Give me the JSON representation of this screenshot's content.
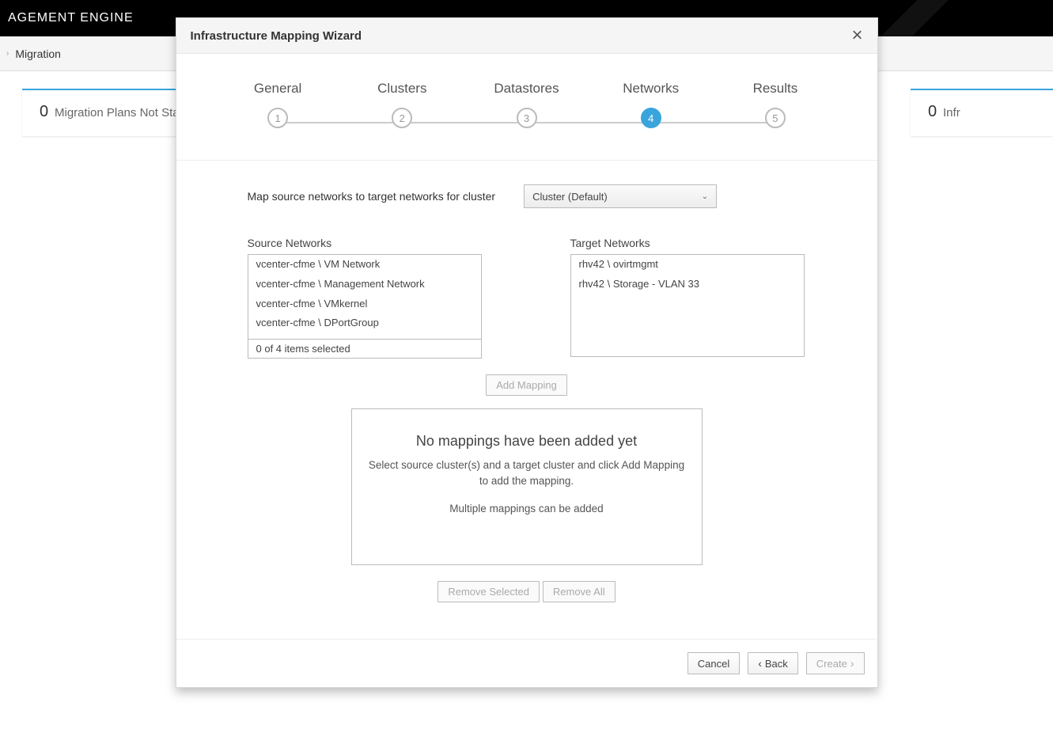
{
  "topbar": {
    "brand_left": "AGEMENT ENGINE"
  },
  "breadcrumb": {
    "item": "Migration"
  },
  "cards": {
    "left_num": "0",
    "left_text": "Migration Plans Not Sta",
    "right_num": "0",
    "right_text": "Infr"
  },
  "modal": {
    "title": "Infrastructure Mapping Wizard",
    "steps": [
      "General",
      "Clusters",
      "Datastores",
      "Networks",
      "Results"
    ],
    "active_step_index": 3,
    "instruction_label": "Map source networks to target networks for cluster",
    "cluster_select_value": "Cluster (Default)",
    "source_title": "Source Networks",
    "source_items": [
      "vcenter-cfme \\ VM Network",
      "vcenter-cfme \\ Management Network",
      "vcenter-cfme \\ VMkernel",
      "vcenter-cfme \\ DPortGroup"
    ],
    "source_footer": "0 of 4 items selected",
    "target_title": "Target Networks",
    "target_items": [
      "rhv42 \\ ovirtmgmt",
      "rhv42 \\ Storage - VLAN 33"
    ],
    "add_mapping_label": "Add Mapping",
    "empty": {
      "heading": "No mappings have been added yet",
      "line1": "Select source cluster(s) and a target cluster and click Add Mapping to add the mapping.",
      "line2": "Multiple mappings can be added"
    },
    "remove_selected_label": "Remove Selected",
    "remove_all_label": "Remove All",
    "footer": {
      "cancel": "Cancel",
      "back": "Back",
      "create": "Create"
    }
  }
}
